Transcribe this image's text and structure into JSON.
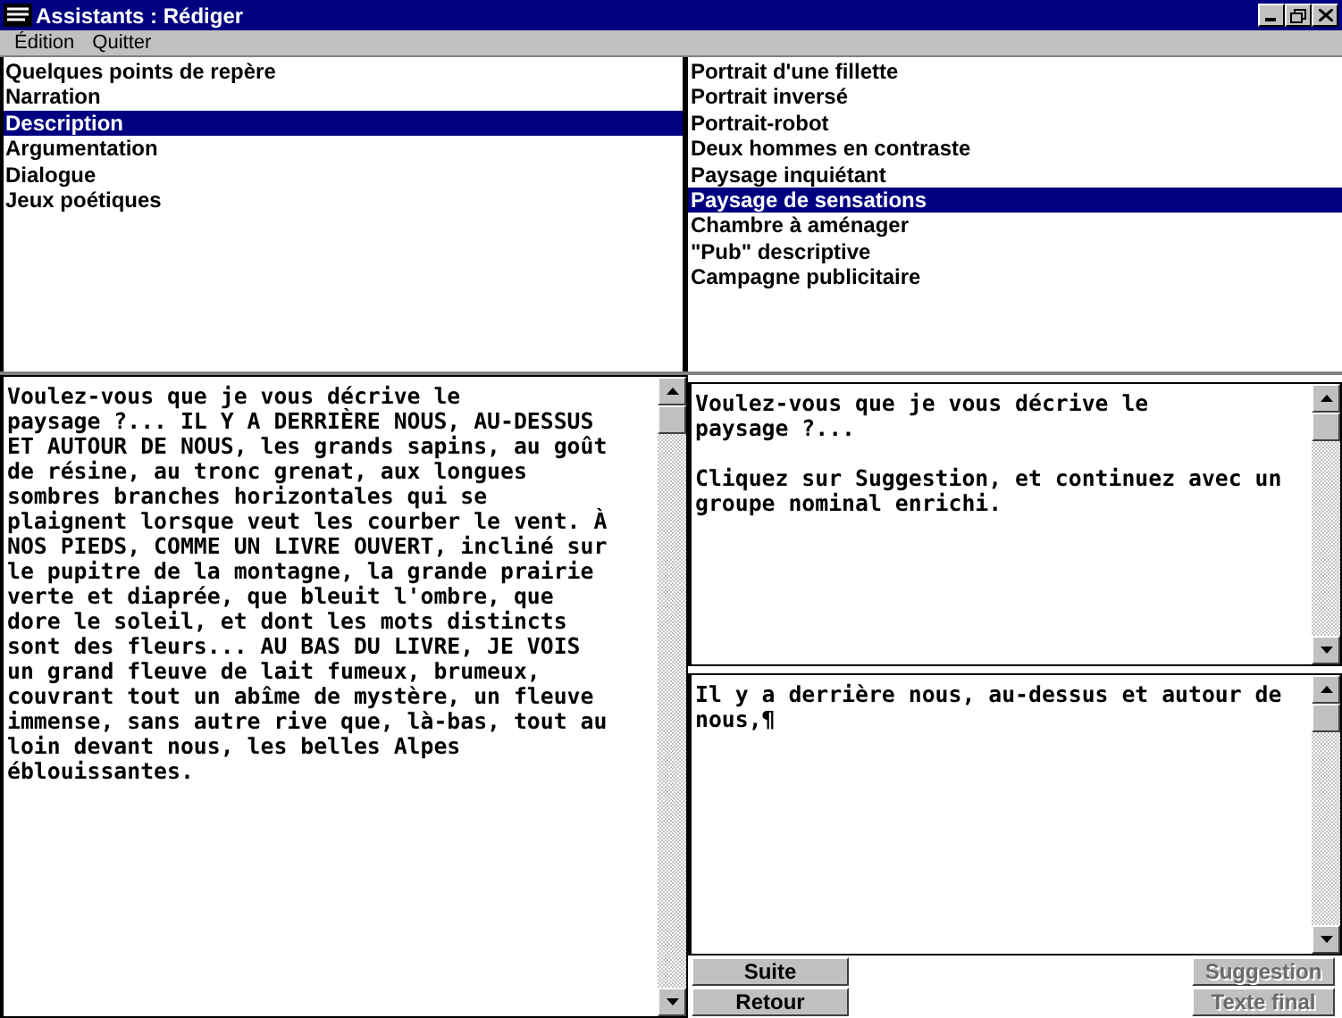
{
  "window": {
    "title": "Assistants : Rédiger"
  },
  "menu": [
    {
      "label": "Édition"
    },
    {
      "label": "Quitter"
    }
  ],
  "categories": [
    {
      "label": "Quelques points de repère",
      "selected": false
    },
    {
      "label": "Narration",
      "selected": false
    },
    {
      "label": "Description",
      "selected": true
    },
    {
      "label": "Argumentation",
      "selected": false
    },
    {
      "label": "Dialogue",
      "selected": false
    },
    {
      "label": "Jeux poétiques",
      "selected": false
    }
  ],
  "exercises": [
    {
      "label": "Portrait d'une fillette",
      "selected": false
    },
    {
      "label": "Portrait inversé",
      "selected": false
    },
    {
      "label": "Portrait-robot",
      "selected": false
    },
    {
      "label": "Deux hommes en contraste",
      "selected": false
    },
    {
      "label": "Paysage inquiétant",
      "selected": false
    },
    {
      "label": "Paysage de sensations",
      "selected": true
    },
    {
      "label": "Chambre à aménager",
      "selected": false
    },
    {
      "label": "\"Pub\" descriptive",
      "selected": false
    },
    {
      "label": "Campagne publicitaire",
      "selected": false
    }
  ],
  "model_text": "Voulez-vous que je vous décrive le\npaysage ?... IL Y A DERRIÈRE NOUS, AU-DESSUS ET AUTOUR DE NOUS, les grands sapins, au goût de résine, au tronc grenat, aux longues sombres branches horizontales qui se plaignent lorsque veut les courber le vent. À NOS PIEDS, COMME UN LIVRE OUVERT, incliné sur le pupitre de la montagne, la grande prairie verte et diaprée, que bleuit l'ombre, que dore le soleil, et dont les mots distincts sont des fleurs... AU BAS DU LIVRE, JE VOIS un grand fleuve de lait fumeux, brumeux, couvrant tout un abîme de mystère, un fleuve immense, sans autre rive que, là-bas, tout au loin devant nous, les belles Alpes éblouissantes.",
  "instructions": [
    "Voulez-vous que je vous décrive le\npaysage ?...",
    "Cliquez sur Suggestion, et continuez avec un groupe nominal enrichi."
  ],
  "answer": {
    "value": "Il y a derrière nous, au-dessus et autour de nous,¶"
  },
  "buttons_left": [
    {
      "label": "Suite",
      "disabled": false
    },
    {
      "label": "Retour",
      "disabled": false
    }
  ],
  "buttons_right": [
    {
      "label": "Suggestion",
      "disabled": true
    },
    {
      "label": "Texte final",
      "disabled": true
    }
  ]
}
